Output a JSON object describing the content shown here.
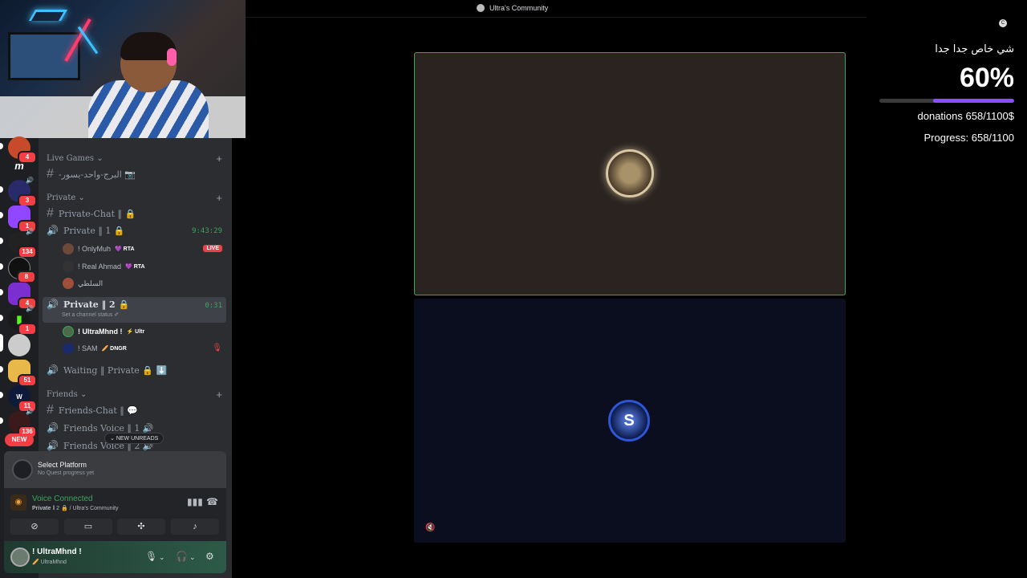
{
  "window": {
    "title": "Ultra's Community"
  },
  "rail": {
    "servers": [
      {
        "name": "server-1",
        "badge": "4"
      },
      {
        "name": "server-2",
        "glyph": "m"
      },
      {
        "name": "server-3",
        "badge": "3"
      },
      {
        "name": "server-4",
        "badge": "1"
      },
      {
        "name": "server-5",
        "badge": "134"
      },
      {
        "name": "server-6",
        "badge": "8"
      },
      {
        "name": "server-7",
        "badge": "4"
      },
      {
        "name": "server-8",
        "badge": "1"
      },
      {
        "name": "server-9",
        "badge": ""
      },
      {
        "name": "server-10",
        "badge": "51"
      },
      {
        "name": "server-11",
        "badge": "11"
      },
      {
        "name": "server-12",
        "badge": "136"
      }
    ],
    "new_label": "NEW"
  },
  "channels": {
    "live_games": {
      "label": "Live Games",
      "channel": "-البرج-واحد-يسور 📷"
    },
    "private": {
      "label": "Private",
      "text_channel": "Private-Chat ‖ 🔒",
      "voice1": {
        "label": "Private ‖ 1 🔒",
        "timer": "9:43:29"
      },
      "voice1_users": [
        {
          "name": "! OnlyMuh",
          "tag": "💜 RTA",
          "live": "LIVE"
        },
        {
          "name": "! Real Ahmad",
          "tag": "💜 RTA"
        },
        {
          "name": "السلطي",
          "tag": ""
        }
      ],
      "voice2": {
        "label": "Private ‖ 2 🔒",
        "timer": "0:31",
        "status": "Set a channel status ✐"
      },
      "voice2_users": [
        {
          "name": "! UltraMhnd !",
          "tag": "⚡ Ultr"
        },
        {
          "name": "! SAM",
          "tag": "🥖 DNGR"
        }
      ],
      "waiting": "Waiting ‖ Private 🔒 ⬇️"
    },
    "friends": {
      "label": "Friends",
      "chat": "Friends-Chat ‖ 💬",
      "voice1": "Friends Voice ‖ 1 🔊",
      "voice2": "Friends Voice ‖ 2 🔊"
    },
    "new_unreads": "NEW UNREADS"
  },
  "quest": {
    "title": "Select Platform",
    "subtitle": "No Quest progress yet"
  },
  "voice": {
    "title": "Voice Connected",
    "subtitle_channel": "Private",
    "subtitle_rest": "‖ 2 🔒 / Ultra's Community"
  },
  "user": {
    "name": "! UltraMhnd !",
    "sub": "🥖 UltraMhnd"
  },
  "donation": {
    "title": "شي خاص جدا جدا",
    "percent_label": "60%",
    "percent_value": 0.6,
    "donations": "donations 658/1100$",
    "progress": "Progress: 658/1100"
  },
  "colors": {
    "accent_green": "#3ba55c",
    "accent_purple": "#8a4dff",
    "live_red": "#ed4245"
  }
}
